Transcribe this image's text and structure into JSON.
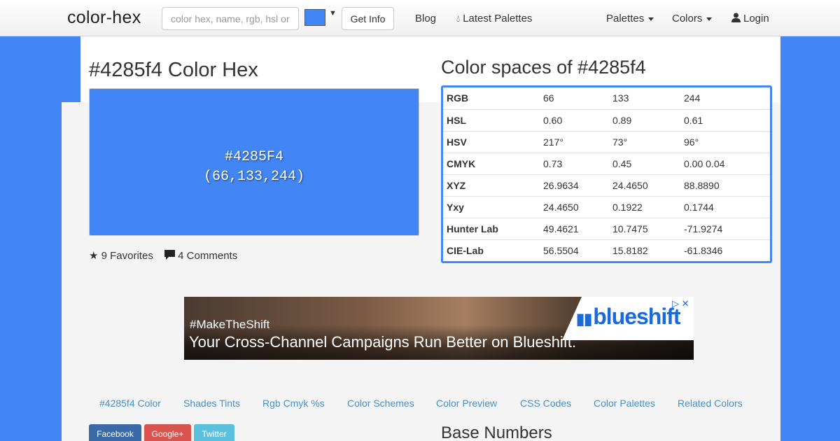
{
  "navbar": {
    "brand": "color-hex",
    "search_placeholder": "color hex, name, rgb, hsl or",
    "get_info_label": "Get Info",
    "blog_label": "Blog",
    "latest_palettes_label": "Latest Palettes",
    "palettes_label": "Palettes",
    "colors_label": "Colors",
    "login_label": "Login",
    "picker_color": "#4285f4"
  },
  "color": {
    "title": "#4285f4 Color Hex",
    "swatch_hex": "#4285F4",
    "swatch_rgb": "(66,133,244)",
    "swatch_color": "#4285f4",
    "favorites": "9 Favorites",
    "comments": "4 Comments"
  },
  "color_spaces": {
    "title": "Color spaces of #4285f4",
    "rows": [
      {
        "label": "RGB",
        "v1": "66",
        "v2": "133",
        "v3": "244"
      },
      {
        "label": "HSL",
        "v1": "0.60",
        "v2": "0.89",
        "v3": "0.61"
      },
      {
        "label": "HSV",
        "v1": "217°",
        "v2": "73°",
        "v3": "96°"
      },
      {
        "label": "CMYK",
        "v1": "0.73",
        "v2": "0.45",
        "v3": "0.00   0.04"
      },
      {
        "label": "XYZ",
        "v1": "26.9634",
        "v2": "24.4650",
        "v3": "88.8890"
      },
      {
        "label": "Yxy",
        "v1": "24.4650",
        "v2": "0.1922",
        "v3": "0.1744"
      },
      {
        "label": "Hunter Lab",
        "v1": "49.4621",
        "v2": "10.7475",
        "v3": "-71.9274"
      },
      {
        "label": "CIE-Lab",
        "v1": "56.5504",
        "v2": "15.8182",
        "v3": "-61.8346"
      }
    ]
  },
  "ad": {
    "tag": "#MakeTheShift",
    "headline": "Your Cross-Channel Campaigns Run Better on Blueshift.",
    "logo": "blueshift",
    "close": "▷ ✕"
  },
  "tabs": [
    "#4285f4 Color",
    "Shades Tints",
    "Rgb Cmyk %s",
    "Color Schemes",
    "Color Preview",
    "CSS Codes",
    "Color Palettes",
    "Related Colors"
  ],
  "share": {
    "facebook": "Facebook",
    "google": "Google+",
    "twitter": "Twitter"
  },
  "base_numbers_title": "Base Numbers"
}
